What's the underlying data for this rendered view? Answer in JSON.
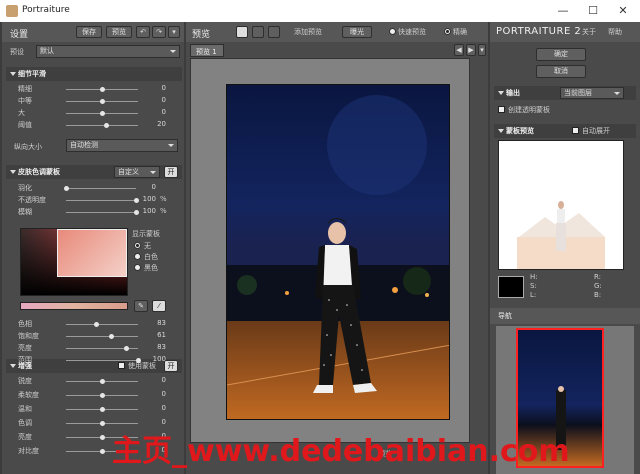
{
  "window": {
    "title": "Portraiture",
    "minimize": "—",
    "maximize": "☐",
    "close": "✕"
  },
  "left": {
    "header": {
      "title": "设置",
      "save": "保存",
      "preview": "预览"
    },
    "preset": {
      "label": "预设",
      "value": "默认"
    },
    "detail": {
      "title": "细节平滑",
      "sliders": [
        {
          "label": "精细",
          "value": "0",
          "pos": 0.5
        },
        {
          "label": "中等",
          "value": "0",
          "pos": 0.5
        },
        {
          "label": "大",
          "value": "0",
          "pos": 0.5
        },
        {
          "label": "阈值",
          "value": "20",
          "pos": 0.56
        }
      ],
      "size_label": "纵向大小",
      "size_value": "自动检测"
    },
    "skin": {
      "title": "皮肤色调蒙板",
      "mode": "自定义",
      "on": "开",
      "sliders": [
        {
          "label": "羽化",
          "value": "0",
          "unit": "",
          "pos": 0.0
        },
        {
          "label": "不透明度",
          "value": "100",
          "unit": "%",
          "pos": 1.0
        },
        {
          "label": "模糊",
          "value": "100",
          "unit": "%",
          "pos": 1.0
        }
      ],
      "show_mask_label": "显示蒙板",
      "mask_options": [
        "无",
        "白色",
        "黑色"
      ],
      "hsl": [
        {
          "label": "色相",
          "value": "83",
          "pos": 0.42
        },
        {
          "label": "饱和度",
          "value": "61",
          "pos": 0.63
        },
        {
          "label": "亮度",
          "value": "83",
          "pos": 0.83
        },
        {
          "label": "范围",
          "value": "100",
          "pos": 1.0
        }
      ]
    },
    "enhance": {
      "title": "增强",
      "use_mask": "使用蒙板",
      "on": "开",
      "sliders": [
        {
          "label": "锐度",
          "value": "0",
          "pos": 0.5
        },
        {
          "label": "柔软度",
          "value": "0",
          "pos": 0.5
        },
        {
          "label": "温和",
          "value": "0",
          "pos": 0.5
        },
        {
          "label": "色调",
          "value": "0",
          "pos": 0.5
        },
        {
          "label": "亮度",
          "value": "0",
          "pos": 0.5
        },
        {
          "label": "对比度",
          "value": "0",
          "pos": 0.5
        }
      ]
    }
  },
  "center": {
    "title": "预览",
    "add_preview": "添加预览",
    "exposure": "曝光",
    "fast_preview": "快速预览",
    "precise": "精确",
    "tab": "预览 1",
    "bottom_text": "预览"
  },
  "right": {
    "brand": "PORTRAITURE 2",
    "about": "关于",
    "help": "帮助",
    "ok": "确定",
    "cancel": "取消",
    "output": {
      "title": "输出",
      "value": "当前图层",
      "create_mask": "创建透明蒙板"
    },
    "mask_preview": {
      "title": "蒙板预览",
      "auto_expand": "自动展开"
    },
    "channels": {
      "H": "H:",
      "S": "S:",
      "L": "L:",
      "R": "R:",
      "G": "G:",
      "B": "B:"
    },
    "nav": {
      "title": "导航"
    }
  },
  "watermark": {
    "text": "主页_www.dedebaibian.com"
  }
}
